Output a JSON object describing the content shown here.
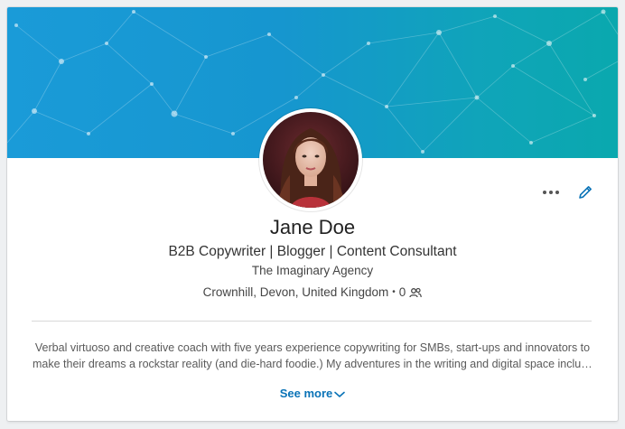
{
  "profile": {
    "name": "Jane Doe",
    "headline": "B2B Copywriter | Blogger | Content Consultant",
    "company": "The Imaginary Agency",
    "location": "Crownhill, Devon, United Kingdom",
    "separator": "•",
    "connections": "0"
  },
  "summary": {
    "line1": "Verbal virtuoso and creative coach with five years experience copywriting for SMBs, start-ups and innovators to",
    "line2": "make their dreams a rockstar reality (and die-hard foodie.) My adventures in the writing and digital space includ…",
    "see_more_label": "See more"
  },
  "icons": {
    "more": "more-horizontal-icon",
    "edit": "pencil-icon",
    "connections": "people-icon",
    "see_more": "chevron-down-icon"
  },
  "colors": {
    "accent": "#0a73b7",
    "banner_start": "#1a9bd8",
    "banner_end": "#0aa8ae"
  }
}
